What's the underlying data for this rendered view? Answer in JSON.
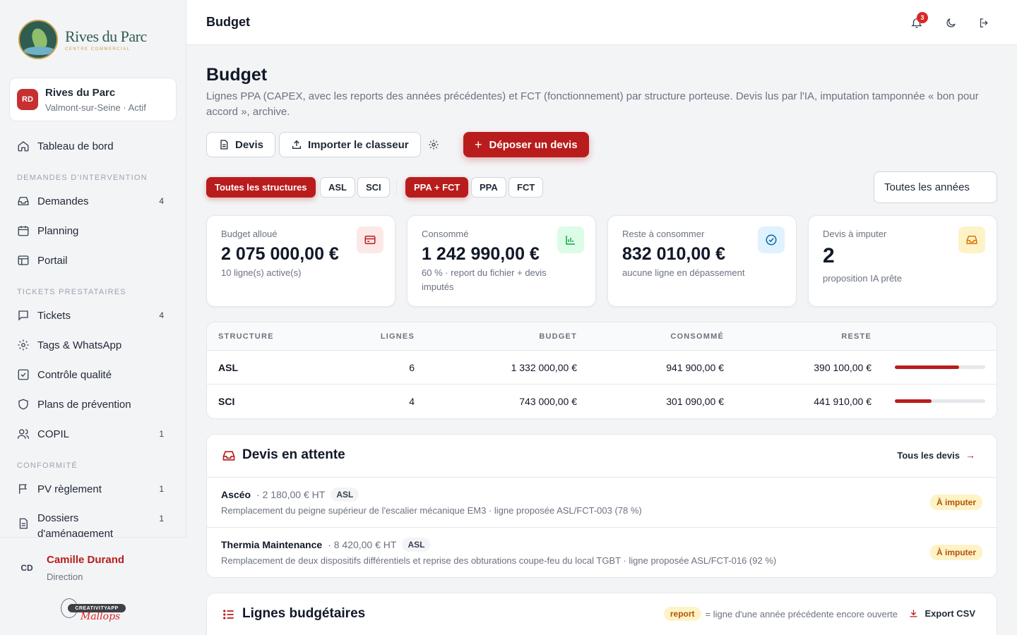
{
  "brand": {
    "name": "Rives du Parc",
    "tagline": "CENTRE COMMERCIAL"
  },
  "site": {
    "badge": "RD",
    "name": "Rives du Parc",
    "sub": "Valmont-sur-Seine · Actif"
  },
  "sidebar": {
    "dashboard": "Tableau de bord",
    "sections": [
      {
        "title": "DEMANDES D'INTERVENTION",
        "items": [
          {
            "label": "Demandes",
            "count": "4",
            "icon": "inbox-icon"
          },
          {
            "label": "Planning",
            "count": "",
            "icon": "calendar-icon"
          },
          {
            "label": "Portail",
            "count": "",
            "icon": "layout-icon"
          }
        ]
      },
      {
        "title": "TICKETS PRESTATAIRES",
        "items": [
          {
            "label": "Tickets",
            "count": "4",
            "icon": "message-icon"
          },
          {
            "label": "Tags & WhatsApp",
            "count": "",
            "icon": "gear-icon"
          },
          {
            "label": "Contrôle qualité",
            "count": "",
            "icon": "checkbox-icon"
          },
          {
            "label": "Plans de prévention",
            "count": "",
            "icon": "shield-icon"
          },
          {
            "label": "COPIL",
            "count": "1",
            "icon": "users-icon"
          }
        ]
      },
      {
        "title": "CONFORMITÉ",
        "items": [
          {
            "label": "PV règlement",
            "count": "1",
            "icon": "flag-icon"
          },
          {
            "label": "Dossiers d'aménagement",
            "count": "1",
            "icon": "document-icon"
          }
        ]
      }
    ]
  },
  "user": {
    "initials": "CD",
    "name": "Camille Durand",
    "role": "Direction"
  },
  "credit": {
    "pill": "CREATIVITYAPP",
    "script": "Mallops"
  },
  "topbar": {
    "title": "Budget",
    "notifications": "3"
  },
  "page": {
    "title": "Budget",
    "description": "Lignes PPA (CAPEX, avec les reports des années précédentes) et FCT (fonctionnement) par structure porteuse. Devis lus par l'IA, imputation tamponnée « bon pour accord », archive."
  },
  "actions": {
    "devis": "Devis",
    "import": "Importer le classeur",
    "deposit": "Déposer un devis"
  },
  "filters": {
    "structures": [
      "Toutes les structures",
      "ASL",
      "SCI"
    ],
    "types": [
      "PPA + FCT",
      "PPA",
      "FCT"
    ],
    "year": "Toutes les années"
  },
  "kpis": [
    {
      "label": "Budget alloué",
      "value": "2 075 000,00 €",
      "sub": "10 ligne(s) active(s)",
      "icon": "card-icon",
      "color": "#fde8e8",
      "icon_color": "#b91c1c"
    },
    {
      "label": "Consommé",
      "value": "1 242 990,00 €",
      "sub": "60 % · report du fichier + devis imputés",
      "icon": "bar-chart-icon",
      "color": "#dcfce7",
      "icon_color": "#16a34a"
    },
    {
      "label": "Reste à consommer",
      "value": "832 010,00 €",
      "sub": "aucune ligne en dépassement",
      "icon": "check-circle-icon",
      "color": "#e0f2fe",
      "icon_color": "#0369a1"
    },
    {
      "label": "Devis à imputer",
      "value": "2",
      "sub": "proposition IA prête",
      "icon": "inbox-icon",
      "color": "#fef3c7",
      "icon_color": "#d97706"
    }
  ],
  "structure_table": {
    "headers": [
      "STRUCTURE",
      "LIGNES",
      "BUDGET",
      "CONSOMMÉ",
      "RESTE"
    ],
    "rows": [
      {
        "structure": "ASL",
        "lignes": "6",
        "budget": "1 332 000,00 €",
        "consomme": "941 900,00 €",
        "reste": "390 100,00 €",
        "progress": 0.71
      },
      {
        "structure": "SCI",
        "lignes": "4",
        "budget": "743 000,00 €",
        "consomme": "301 090,00 €",
        "reste": "441 910,00 €",
        "progress": 0.41
      }
    ]
  },
  "pending": {
    "title": "Devis en attente",
    "link": "Tous les devis",
    "items": [
      {
        "vendor": "Ascéo",
        "amount": "· 2 180,00 € HT",
        "tag": "ASL",
        "desc": "Remplacement du peigne supérieur de l'escalier mécanique EM3 · ligne proposée ASL/FCT-003 (78 %)",
        "status": "À imputer"
      },
      {
        "vendor": "Thermia Maintenance",
        "amount": "· 8 420,00 € HT",
        "tag": "ASL",
        "desc": "Remplacement de deux dispositifs différentiels et reprise des obturations coupe-feu du local TGBT · ligne proposée ASL/FCT-016 (92 %)",
        "status": "À imputer"
      }
    ]
  },
  "budget_lines": {
    "title": "Lignes budgétaires",
    "report_chip": "report",
    "report_legend": "= ligne d'une année précédente encore ouverte",
    "export": "Export CSV"
  }
}
